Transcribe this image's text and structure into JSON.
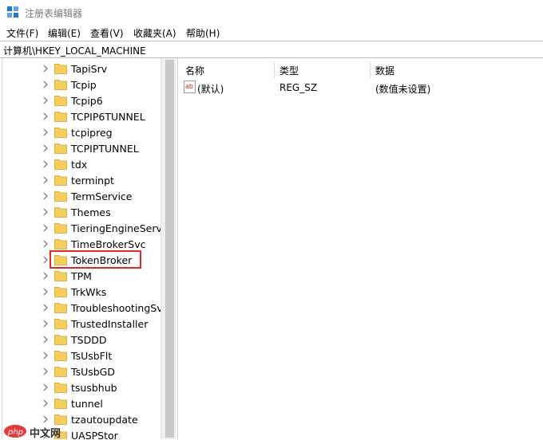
{
  "window": {
    "title": "注册表编辑器"
  },
  "menu": [
    "文件(F)",
    "编辑(E)",
    "查看(V)",
    "收藏夹(A)",
    "帮助(H)"
  ],
  "address": "计算机\\HKEY_LOCAL_MACHINE",
  "tree_items": [
    {
      "label": "TapiSrv",
      "expandable": true
    },
    {
      "label": "Tcpip",
      "expandable": true
    },
    {
      "label": "Tcpip6",
      "expandable": true
    },
    {
      "label": "TCPIP6TUNNEL",
      "expandable": true
    },
    {
      "label": "tcpipreg",
      "expandable": true
    },
    {
      "label": "TCPIPTUNNEL",
      "expandable": true
    },
    {
      "label": "tdx",
      "expandable": true
    },
    {
      "label": "terminpt",
      "expandable": true
    },
    {
      "label": "TermService",
      "expandable": true
    },
    {
      "label": "Themes",
      "expandable": true
    },
    {
      "label": "TieringEngineService",
      "expandable": true
    },
    {
      "label": "TimeBrokerSvc",
      "expandable": true
    },
    {
      "label": "TokenBroker",
      "expandable": true
    },
    {
      "label": "TPM",
      "expandable": true
    },
    {
      "label": "TrkWks",
      "expandable": true
    },
    {
      "label": "TroubleshootingSvc",
      "expandable": true
    },
    {
      "label": "TrustedInstaller",
      "expandable": true
    },
    {
      "label": "TSDDD",
      "expandable": true
    },
    {
      "label": "TsUsbFlt",
      "expandable": true
    },
    {
      "label": "TsUsbGD",
      "expandable": true
    },
    {
      "label": "tsusbhub",
      "expandable": true
    },
    {
      "label": "tunnel",
      "expandable": true
    },
    {
      "label": "tzautoupdate",
      "expandable": true
    },
    {
      "label": "UASPStor",
      "expandable": true
    }
  ],
  "highlighted_item": "TokenBroker",
  "list": {
    "columns": [
      "名称",
      "类型",
      "数据"
    ],
    "rows": [
      {
        "name": "(默认)",
        "type": "REG_SZ",
        "data": "(数值未设置)"
      }
    ]
  },
  "watermark": {
    "text": "中文网"
  },
  "colors": {
    "folder": "#f4cf5f",
    "highlight": "#e02828",
    "accent": "#1f76c8"
  }
}
